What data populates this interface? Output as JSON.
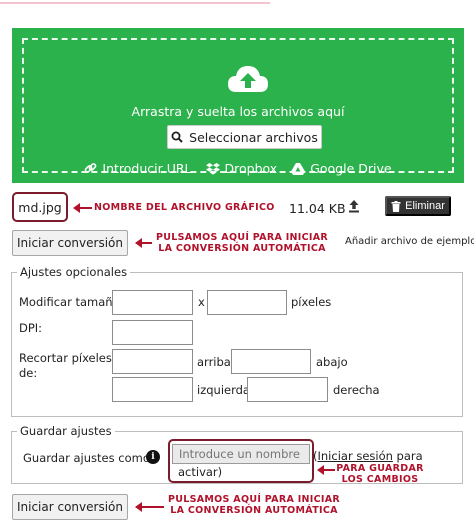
{
  "dropzone": {
    "drag_text": "Arrastra y suelta los archivos aquí",
    "select_label": "Seleccionar archivos",
    "sources": [
      {
        "label": "Introducir URL",
        "icon": "link-icon"
      },
      {
        "label": "Dropbox",
        "icon": "dropbox-icon"
      },
      {
        "label": "Google Drive",
        "icon": "google-drive-icon"
      }
    ]
  },
  "file": {
    "name": "md.jpg",
    "size": "11.04 KB",
    "delete_label": "Eliminar"
  },
  "annotations": {
    "file_name": "NOMBRE DEL ARCHIVO GRÁFICO",
    "convert_top_line1": "PULSAMOS AQUÍ PARA INICIAR",
    "convert_top_line2": "LA CONVERSIÓN AUTOMÁTICA",
    "save_line1": "PARA GUARDAR",
    "save_line2": "LOS CAMBIOS",
    "convert_bottom_line1": "PULSAMOS AQUÍ PARA INICIAR",
    "convert_bottom_line2": "LA CONVERSIÓN AUTOMÁTICA"
  },
  "actions": {
    "convert_label": "Iniciar conversión",
    "sample_link": "Añadir archivo de ejemplo"
  },
  "optional_settings": {
    "legend": "Ajustes opcionales",
    "resize_label": "Modificar tamaño:",
    "x_sep": "x",
    "pixels": "píxeles",
    "dpi_label": "DPI:",
    "crop_label_line1": "Recortar píxeles",
    "crop_label_line2": "de:",
    "top": "arriba",
    "bottom": "abajo",
    "left": "izquierda",
    "right": "derecha"
  },
  "save_settings": {
    "legend": "Guardar ajustes",
    "save_as_label": "Guardar ajustes como:",
    "name_placeholder": "Introduce un nombre",
    "login_link": "Iniciar sesión",
    "suffix_1": " para",
    "suffix_2": "activar)"
  },
  "colors": {
    "dropzone_green": "#2bb24c",
    "annotation_red": "#b1122b",
    "highlight_border": "#7a1c2b"
  }
}
